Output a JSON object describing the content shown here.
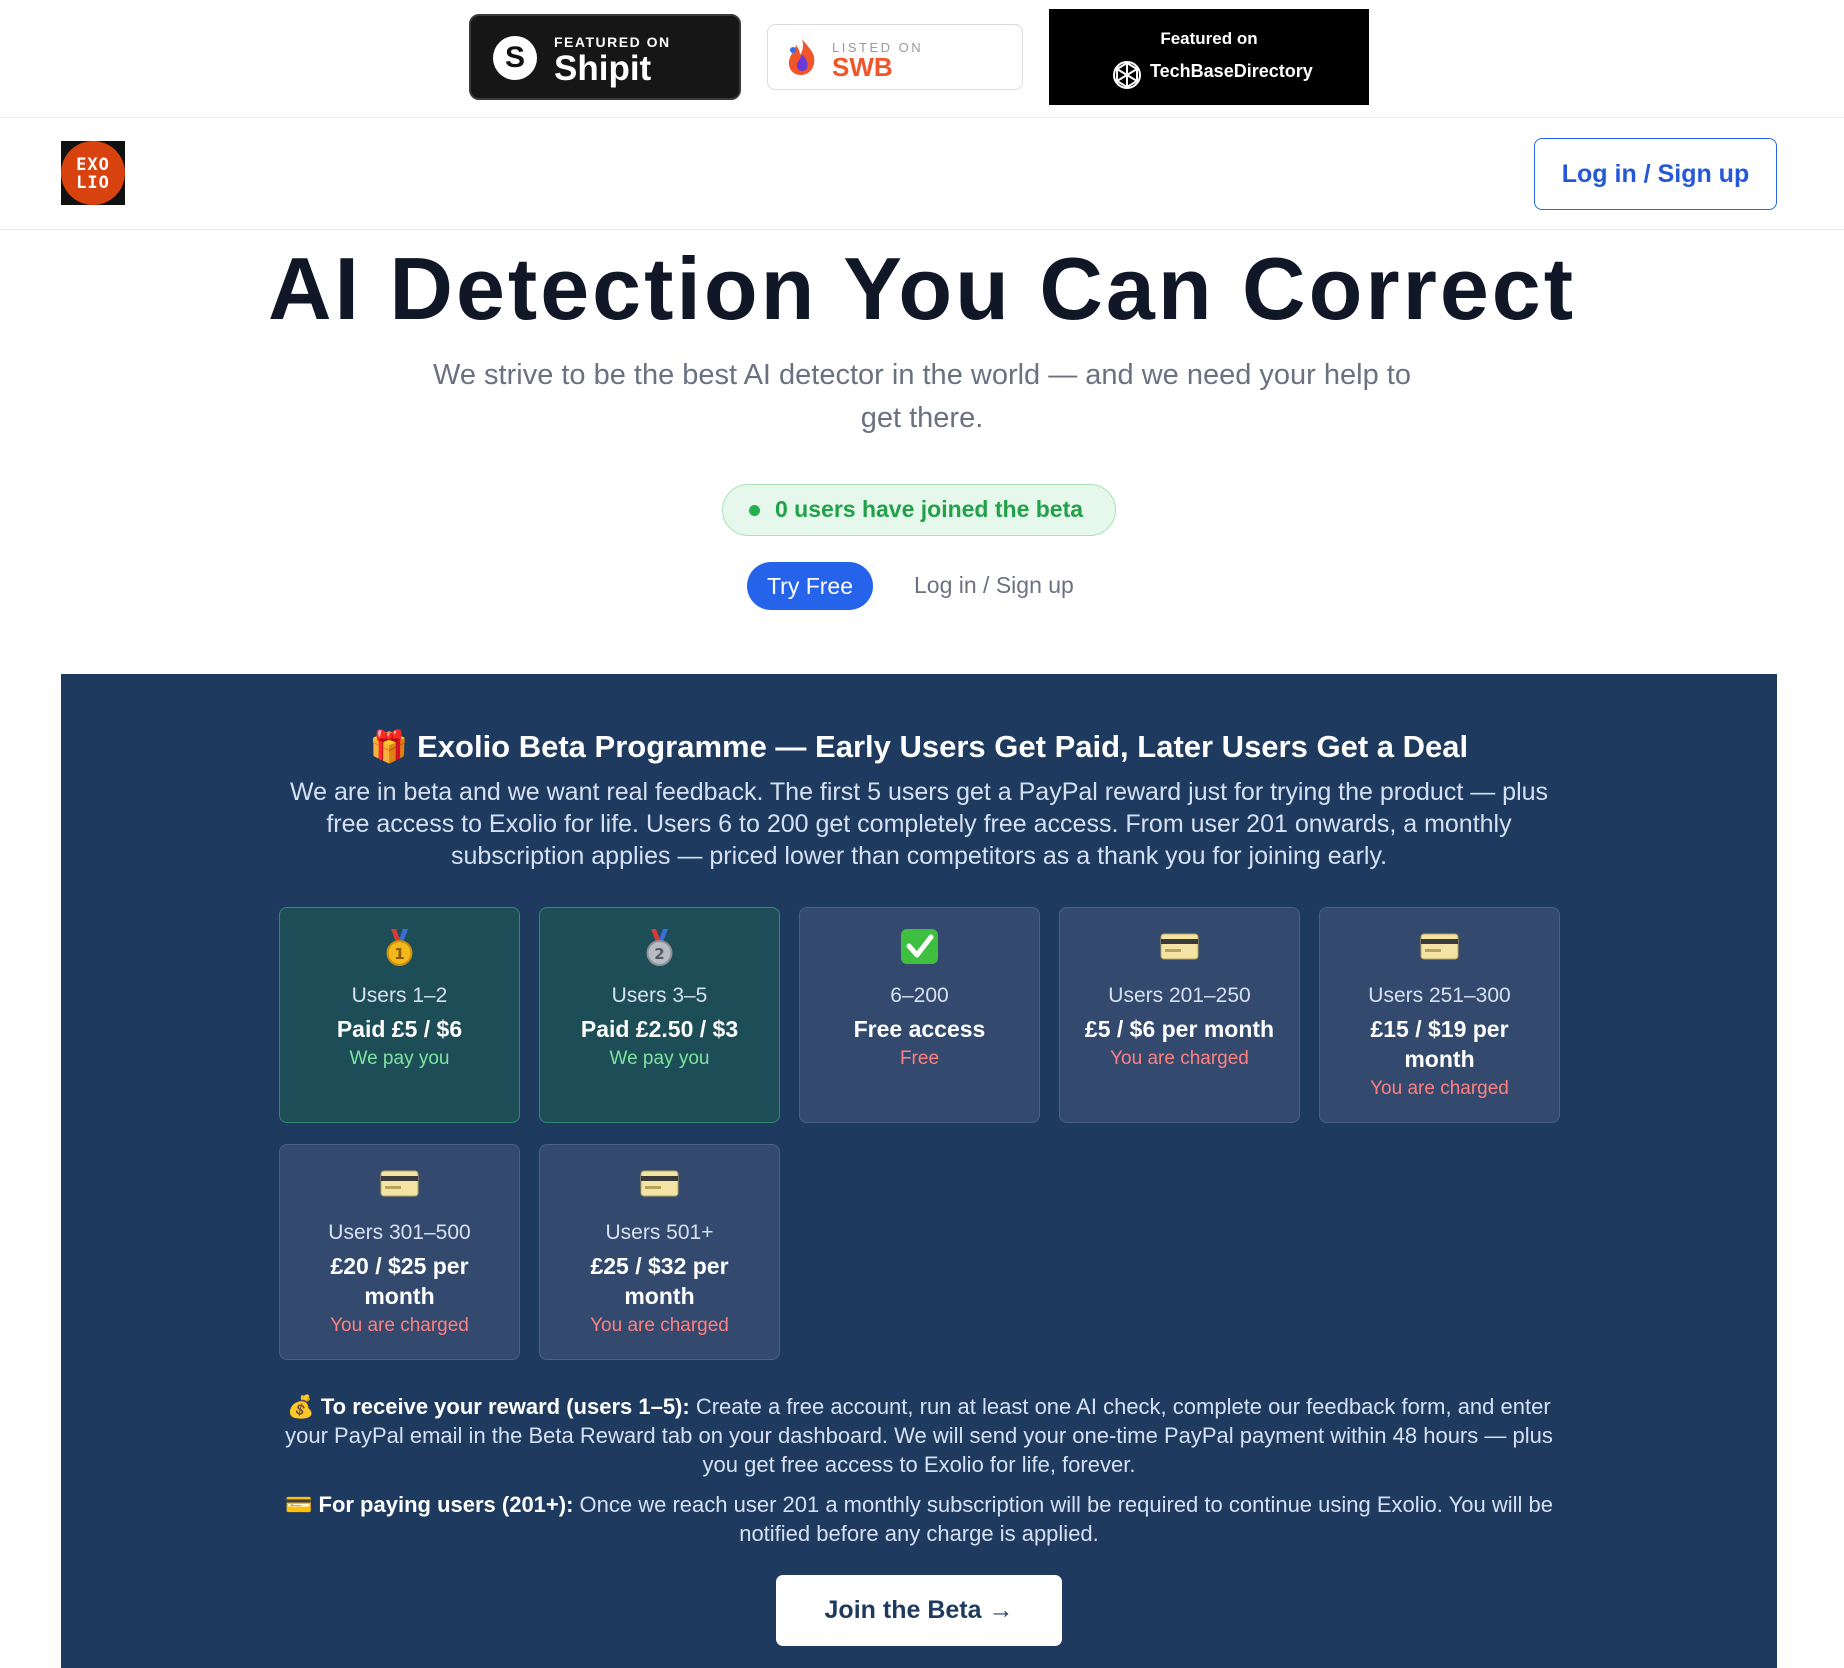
{
  "badges": {
    "shipit": {
      "top": "FEATURED ON",
      "name": "Shipit",
      "letter": "S"
    },
    "swb": {
      "top": "LISTED ON",
      "name": "SWB"
    },
    "techbase": {
      "top": "Featured on",
      "name": "TechBaseDirectory"
    }
  },
  "nav": {
    "logo_line1": "EXO",
    "logo_line2": "LIO",
    "login_label": "Log in / Sign up"
  },
  "hero": {
    "title": "AI Detection You Can Correct",
    "subtitle": "We strive to be the best AI detector in the world — and we need your help to get there.",
    "beta_count_text": "0 users have joined the beta",
    "try_free_label": "Try Free",
    "login_label": "Log in / Sign up"
  },
  "beta": {
    "title": "🎁 Exolio Beta Programme — Early Users Get Paid, Later Users Get a Deal",
    "intro": "We are in beta and we want real feedback. The first 5 users get a PayPal reward just for trying the product — plus free access to Exolio for life. Users 6 to 200 get completely free access. From user 201 onwards, a monthly subscription applies — priced lower than competitors as a thank you for joining early.",
    "tiers": [
      {
        "icon": "gold-medal-icon",
        "range": "Users 1–2",
        "price": "Paid £5 / $6",
        "note": "We pay you"
      },
      {
        "icon": "silver-medal-icon",
        "range": "Users 3–5",
        "price": "Paid £2.50 / $3",
        "note": "We pay you"
      },
      {
        "icon": "check-mark-icon",
        "range": "6–200",
        "price": "Free access",
        "note": "Free"
      },
      {
        "icon": "credit-card-icon",
        "range": "Users 201–250",
        "price": "£5 / $6 per month",
        "note": "You are charged"
      },
      {
        "icon": "credit-card-icon",
        "range": "Users 251–300",
        "price": "£15 / $19 per month",
        "note": "You are charged"
      },
      {
        "icon": "credit-card-icon",
        "range": "Users 301–500",
        "price": "£20 / $25 per month",
        "note": "You are charged"
      },
      {
        "icon": "credit-card-icon",
        "range": "Users 501+",
        "price": "£25 / $32 per month",
        "note": "You are charged"
      }
    ],
    "reward_heading": "💰 To receive your reward (users 1–5):",
    "reward_text": " Create a free account, run at least one AI check, complete our feedback form, and enter your PayPal email in the Beta Reward tab on your dashboard. We will send your one-time PayPal payment within 48 hours — plus you get free access to Exolio for life, forever.",
    "paying_heading": "💳 For paying users (201+):",
    "paying_text": " Once we reach user 201 a monthly subscription will be required to continue using Exolio. You will be notified before any charge is applied.",
    "join_label": "Join the Beta →"
  },
  "colors": {
    "primary": "#2563eb",
    "panel": "#1f3a5f",
    "positive": "#7fe3a0",
    "charged": "#ff8080",
    "logo": "#d7420f"
  }
}
